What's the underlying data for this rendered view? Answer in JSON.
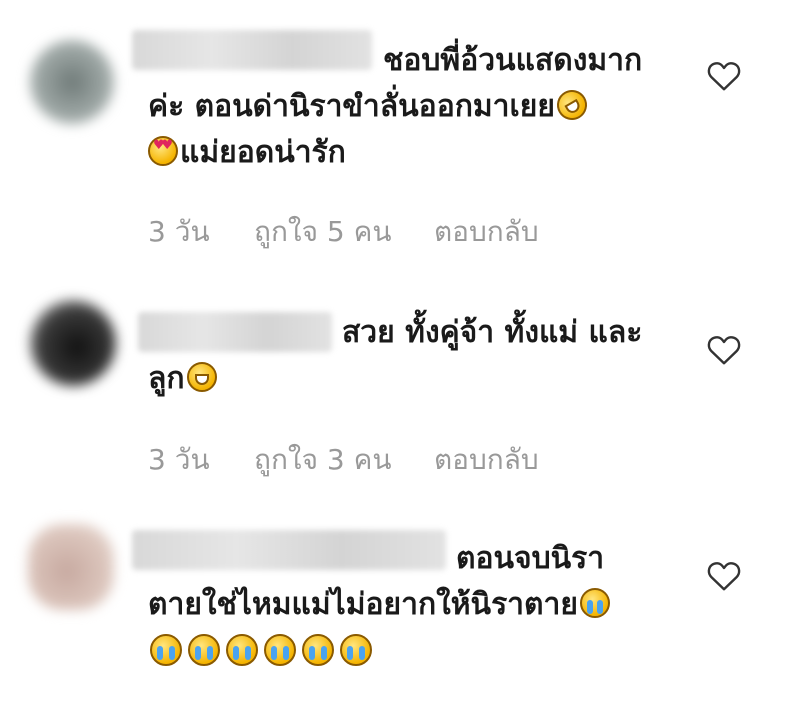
{
  "comments": [
    {
      "line1": "ชอบพี่อ้วนแสดงมาก",
      "line2": "ค่ะ ตอนด่านิราขำลั่นออกมาเยย",
      "line3": "แม่ยอดน่ารัก",
      "time": "3 วัน",
      "likes": "ถูกใจ 5 คน",
      "reply": "ตอบกลับ"
    },
    {
      "line1": "สวย ทั้งคู่จ้า ทั้งแม่ และ",
      "line2": "ลูก",
      "time": "3 วัน",
      "likes": "ถูกใจ 3 คน",
      "reply": "ตอบกลับ"
    },
    {
      "line1": "ตอนจบนิรา",
      "line2": "ตายใช่ไหมแม่ไม่อยากให้นิราตาย"
    }
  ],
  "icons": {
    "like": "heart-outline-icon",
    "emoji_rofl": "rolling-on-floor-laughing-emoji",
    "emoji_heart_eyes": "heart-eyes-emoji",
    "emoji_grin": "grinning-emoji",
    "emoji_cry": "loudly-crying-emoji"
  },
  "colors": {
    "text": "#1a1a1a",
    "meta": "#999999",
    "background": "#ffffff"
  }
}
